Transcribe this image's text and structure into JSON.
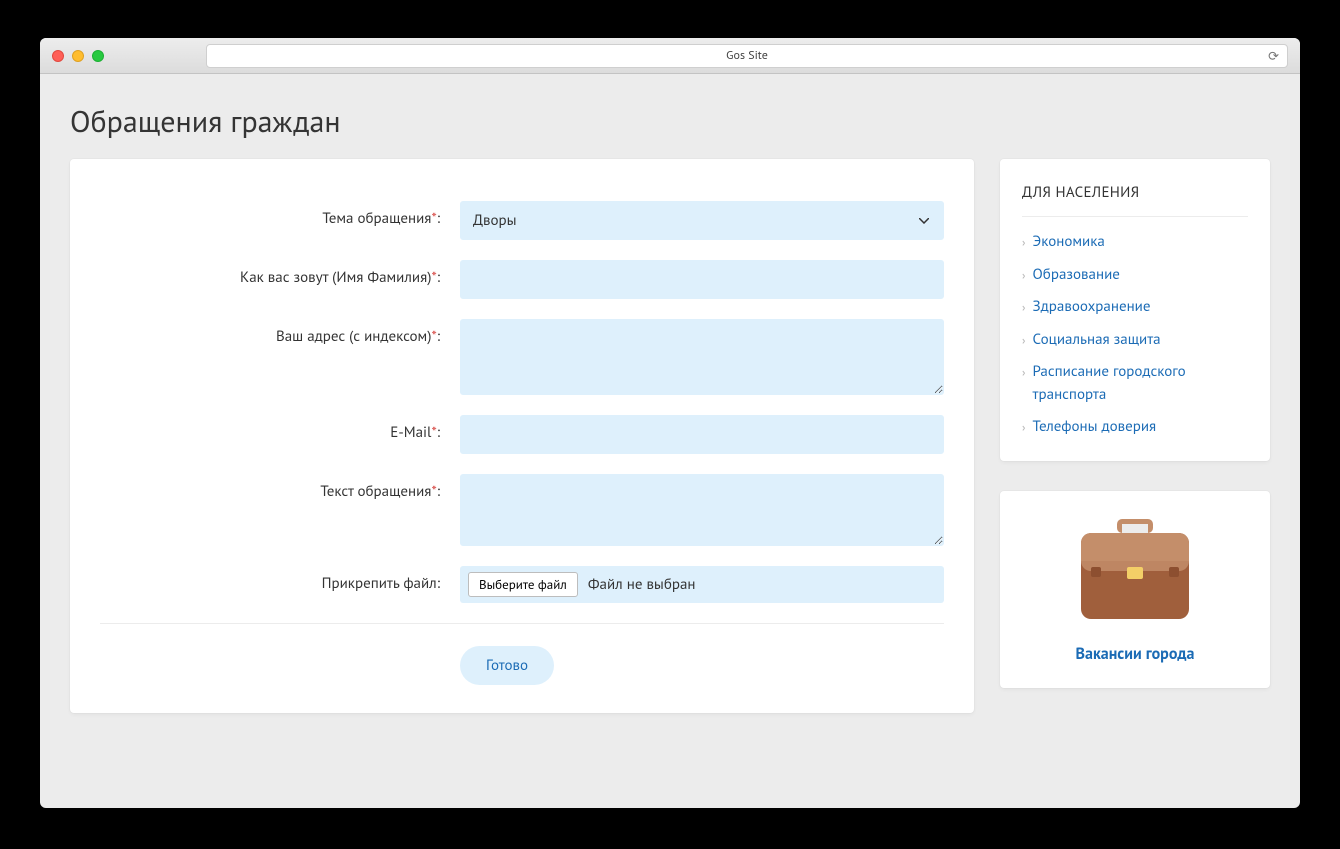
{
  "browser": {
    "title": "Gos Site"
  },
  "page": {
    "heading": "Обращения граждан"
  },
  "form": {
    "fields": {
      "topic": {
        "label": "Тема обращения",
        "selected": "Дворы"
      },
      "name": {
        "label": "Как вас зовут (Имя Фамилия)",
        "value": ""
      },
      "address": {
        "label": "Ваш адрес (с индексом)",
        "value": ""
      },
      "email": {
        "label": "E-Mail",
        "value": ""
      },
      "message": {
        "label": "Текст обращения",
        "value": ""
      },
      "file": {
        "label": "Прикрепить файл:",
        "button": "Выберите файл",
        "status": "Файл не выбран"
      }
    },
    "required_mark": "*",
    "submit": "Готово"
  },
  "sidebar": {
    "population": {
      "title": "ДЛЯ НАСЕЛЕНИЯ",
      "items": [
        "Экономика",
        "Образование",
        "Здравоохранение",
        "Социальная защита",
        "Расписание городского транспорта",
        "Телефоны доверия"
      ]
    },
    "vacancies": {
      "label": "Вакансии города"
    }
  }
}
